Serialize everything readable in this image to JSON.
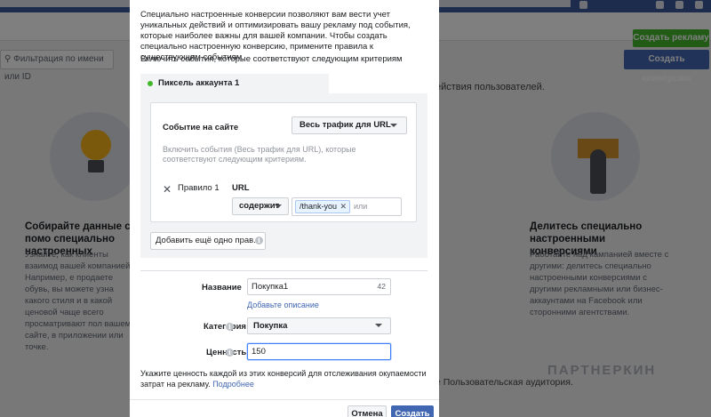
{
  "background": {
    "create_ad_button": "Создать рекламу",
    "filter_placeholder": "Фильтрация по имени или ID",
    "filter_icon": "search-icon",
    "create_conversion_button": "Создать конверсию",
    "page_description_fragment": "ействия пользователей.",
    "card_left": {
      "title": "Собирайте данные с помо специально настроенных",
      "text": "Узнайте, как клиенты взаимод вашей компанией. Например, е продаете обувь, вы можете узна какого стиля и в какой ценовой чаще всего просматривают пол вашем сайте, в приложении или точке."
    },
    "card_right": {
      "title": "Делитесь специально настроенными конверсиями",
      "text": "Работайте над кампанией вместе с другими: делитесь специально настроенными конверсиями с другими рекламными или бизнес-аккаунтами на Facebook или сторонними агентствами."
    },
    "audience_fragment": "е Пользовательская аудитория.",
    "watermark": "ПАРТНЕРКИН"
  },
  "modal": {
    "intro": "Специально настроенные конверсии позволяют вам вести учет уникальных действий и оптимизировать вашу рекламу под события, которые наиболее важны для вашей компании. Чтобы создать специально настроенную конверсию, примените правила к существующим событиям.",
    "include_label": "Включить события, которые соответствуют следующим критериям",
    "pixel_name": "Пиксель аккаунта 1",
    "pixel_status_color": "#42b72a",
    "event_label": "Событие на сайте",
    "event_value": "Весь трафик для URL",
    "event_hint": "Включить события (Весь трафик для URL), которые соответствуют следующим критериям.",
    "rule_label": "Правило 1",
    "rule_remove_icon": "close-icon",
    "url_label": "URL",
    "operator_value": "содержит",
    "url_tag": "/thank-you",
    "or_placeholder": "или",
    "add_rule_button": "Добавить ещё одно прав...",
    "name_label": "Название",
    "name_value": "Покупка1",
    "name_char_count": "42",
    "add_description_link": "Добавьте описание",
    "category_label": "Категория",
    "category_value": "Покупка",
    "value_label": "Ценность",
    "value_input": "150",
    "value_note": "Укажите ценность каждой из этих конверсий для отслеживания окупаемости затрат на рекламу.",
    "learn_more_link": "Подробнее",
    "cancel_button": "Отмена",
    "create_button": "Создать",
    "accent_color": "#4267b2"
  }
}
